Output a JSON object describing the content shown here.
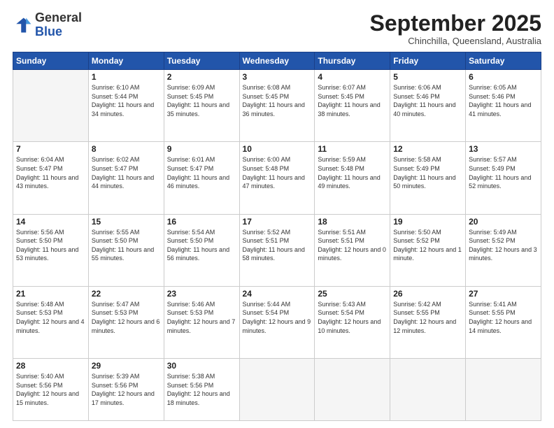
{
  "logo": {
    "general": "General",
    "blue": "Blue"
  },
  "header": {
    "month": "September 2025",
    "location": "Chinchilla, Queensland, Australia"
  },
  "weekdays": [
    "Sunday",
    "Monday",
    "Tuesday",
    "Wednesday",
    "Thursday",
    "Friday",
    "Saturday"
  ],
  "weeks": [
    [
      {
        "day": "",
        "empty": true
      },
      {
        "day": "1",
        "sunrise": "6:10 AM",
        "sunset": "5:44 PM",
        "daylight": "11 hours and 34 minutes."
      },
      {
        "day": "2",
        "sunrise": "6:09 AM",
        "sunset": "5:45 PM",
        "daylight": "11 hours and 35 minutes."
      },
      {
        "day": "3",
        "sunrise": "6:08 AM",
        "sunset": "5:45 PM",
        "daylight": "11 hours and 36 minutes."
      },
      {
        "day": "4",
        "sunrise": "6:07 AM",
        "sunset": "5:45 PM",
        "daylight": "11 hours and 38 minutes."
      },
      {
        "day": "5",
        "sunrise": "6:06 AM",
        "sunset": "5:46 PM",
        "daylight": "11 hours and 40 minutes."
      },
      {
        "day": "6",
        "sunrise": "6:05 AM",
        "sunset": "5:46 PM",
        "daylight": "11 hours and 41 minutes."
      }
    ],
    [
      {
        "day": "7",
        "sunrise": "6:04 AM",
        "sunset": "5:47 PM",
        "daylight": "11 hours and 43 minutes."
      },
      {
        "day": "8",
        "sunrise": "6:02 AM",
        "sunset": "5:47 PM",
        "daylight": "11 hours and 44 minutes."
      },
      {
        "day": "9",
        "sunrise": "6:01 AM",
        "sunset": "5:47 PM",
        "daylight": "11 hours and 46 minutes."
      },
      {
        "day": "10",
        "sunrise": "6:00 AM",
        "sunset": "5:48 PM",
        "daylight": "11 hours and 47 minutes."
      },
      {
        "day": "11",
        "sunrise": "5:59 AM",
        "sunset": "5:48 PM",
        "daylight": "11 hours and 49 minutes."
      },
      {
        "day": "12",
        "sunrise": "5:58 AM",
        "sunset": "5:49 PM",
        "daylight": "11 hours and 50 minutes."
      },
      {
        "day": "13",
        "sunrise": "5:57 AM",
        "sunset": "5:49 PM",
        "daylight": "11 hours and 52 minutes."
      }
    ],
    [
      {
        "day": "14",
        "sunrise": "5:56 AM",
        "sunset": "5:50 PM",
        "daylight": "11 hours and 53 minutes."
      },
      {
        "day": "15",
        "sunrise": "5:55 AM",
        "sunset": "5:50 PM",
        "daylight": "11 hours and 55 minutes."
      },
      {
        "day": "16",
        "sunrise": "5:54 AM",
        "sunset": "5:50 PM",
        "daylight": "11 hours and 56 minutes."
      },
      {
        "day": "17",
        "sunrise": "5:52 AM",
        "sunset": "5:51 PM",
        "daylight": "11 hours and 58 minutes."
      },
      {
        "day": "18",
        "sunrise": "5:51 AM",
        "sunset": "5:51 PM",
        "daylight": "12 hours and 0 minutes."
      },
      {
        "day": "19",
        "sunrise": "5:50 AM",
        "sunset": "5:52 PM",
        "daylight": "12 hours and 1 minute."
      },
      {
        "day": "20",
        "sunrise": "5:49 AM",
        "sunset": "5:52 PM",
        "daylight": "12 hours and 3 minutes."
      }
    ],
    [
      {
        "day": "21",
        "sunrise": "5:48 AM",
        "sunset": "5:53 PM",
        "daylight": "12 hours and 4 minutes."
      },
      {
        "day": "22",
        "sunrise": "5:47 AM",
        "sunset": "5:53 PM",
        "daylight": "12 hours and 6 minutes."
      },
      {
        "day": "23",
        "sunrise": "5:46 AM",
        "sunset": "5:53 PM",
        "daylight": "12 hours and 7 minutes."
      },
      {
        "day": "24",
        "sunrise": "5:44 AM",
        "sunset": "5:54 PM",
        "daylight": "12 hours and 9 minutes."
      },
      {
        "day": "25",
        "sunrise": "5:43 AM",
        "sunset": "5:54 PM",
        "daylight": "12 hours and 10 minutes."
      },
      {
        "day": "26",
        "sunrise": "5:42 AM",
        "sunset": "5:55 PM",
        "daylight": "12 hours and 12 minutes."
      },
      {
        "day": "27",
        "sunrise": "5:41 AM",
        "sunset": "5:55 PM",
        "daylight": "12 hours and 14 minutes."
      }
    ],
    [
      {
        "day": "28",
        "sunrise": "5:40 AM",
        "sunset": "5:56 PM",
        "daylight": "12 hours and 15 minutes."
      },
      {
        "day": "29",
        "sunrise": "5:39 AM",
        "sunset": "5:56 PM",
        "daylight": "12 hours and 17 minutes."
      },
      {
        "day": "30",
        "sunrise": "5:38 AM",
        "sunset": "5:56 PM",
        "daylight": "12 hours and 18 minutes."
      },
      {
        "day": "",
        "empty": true
      },
      {
        "day": "",
        "empty": true
      },
      {
        "day": "",
        "empty": true
      },
      {
        "day": "",
        "empty": true
      }
    ]
  ]
}
